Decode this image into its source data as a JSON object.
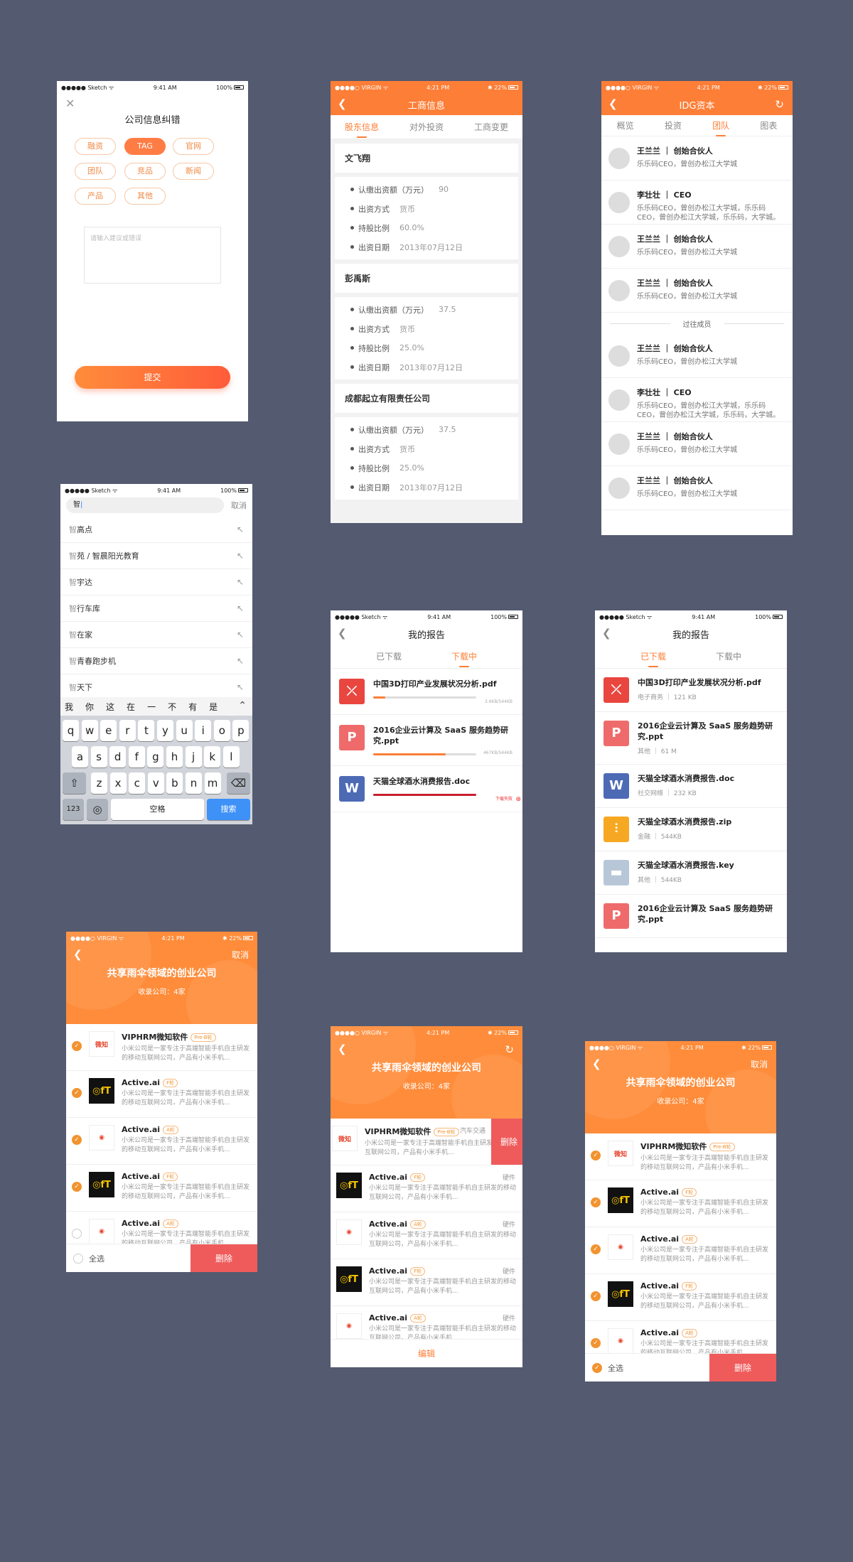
{
  "status": {
    "carrier_sketch": "●●●●● Sketch ᯤ",
    "time_941": "9:41 AM",
    "battery_100": "100%",
    "carrier_virgin": "●●●●○ VIRGIN ᯤ",
    "time_421": "4:21 PM",
    "battery_22": "✱ 22%"
  },
  "feedback": {
    "title": "公司信息纠错",
    "chips": [
      "融资",
      "TAG",
      "官网",
      "团队",
      "竞品",
      "新闻",
      "产品",
      "其他"
    ],
    "placeholder": "请输入建议或错误",
    "submit": "提交"
  },
  "business": {
    "title": "工商信息",
    "tabs": [
      "股东信息",
      "对外投资",
      "工商变更"
    ],
    "labels": [
      "认缴出资额（万元）",
      "出资方式",
      "持股比例",
      "出资日期"
    ],
    "holders": [
      {
        "name": "文飞翔",
        "values": [
          "90",
          "货币",
          "60.0%",
          "2013年07月12日"
        ]
      },
      {
        "name": "彭禹斯",
        "values": [
          "37.5",
          "货币",
          "25.0%",
          "2013年07月12日"
        ]
      },
      {
        "name": "成都起立有限责任公司",
        "values": [
          "37.5",
          "货币",
          "25.0%",
          "2013年07月12日"
        ]
      }
    ]
  },
  "idg": {
    "title": "IDG资本",
    "tabs": [
      "概览",
      "投资",
      "团队",
      "图表"
    ],
    "members": [
      {
        "name": "王兰兰 ｜ 创始合伙人",
        "desc": "乐乐码CEO，曾创办松江大学城"
      },
      {
        "name": "李壮壮 ｜ CEO",
        "desc": "乐乐码CEO，曾创办松江大学城，乐乐码CEO，曾创办松江大学城，乐乐码，大学城。"
      },
      {
        "name": "王兰兰 ｜ 创始合伙人",
        "desc": "乐乐码CEO，曾创办松江大学城"
      },
      {
        "name": "王兰兰 ｜ 创始合伙人",
        "desc": "乐乐码CEO，曾创办松江大学城"
      }
    ],
    "past_label": "过往成员",
    "past_members": [
      {
        "name": "王兰兰 ｜ 创始合伙人",
        "desc": "乐乐码CEO，曾创办松江大学城"
      },
      {
        "name": "李壮壮 ｜ CEO",
        "desc": "乐乐码CEO，曾创办松江大学城，乐乐码CEO，曾创办松江大学城，乐乐码，大学城。"
      },
      {
        "name": "王兰兰 ｜ 创始合伙人",
        "desc": "乐乐码CEO，曾创办松江大学城"
      },
      {
        "name": "王兰兰 ｜ 创始合伙人",
        "desc": "乐乐码CEO，曾创办松江大学城"
      }
    ]
  },
  "search": {
    "query": "智",
    "cancel": "取消",
    "suggestions": [
      "智高点",
      "智苑 / 智晨阳光教育",
      "智宇达",
      "智行车库",
      "智在家",
      "智青春跑步机",
      "智天下"
    ],
    "candidates": [
      "我",
      "你",
      "这",
      "在",
      "一",
      "不",
      "有",
      "是"
    ],
    "row1": [
      "q",
      "w",
      "e",
      "r",
      "t",
      "y",
      "u",
      "i",
      "o",
      "p"
    ],
    "row2": [
      "a",
      "s",
      "d",
      "f",
      "g",
      "h",
      "j",
      "k",
      "l"
    ],
    "row3": [
      "z",
      "x",
      "c",
      "v",
      "b",
      "n",
      "m"
    ],
    "num": "123",
    "space": "空格",
    "go": "搜索"
  },
  "reports_downloading": {
    "title": "我的报告",
    "tabs": [
      "已下载",
      "下载中"
    ],
    "items": [
      {
        "name": "中国3D打印产业发展状况分析.pdf",
        "icon": "pdf",
        "progress": 0.12,
        "meta": "3.6KB/544KB"
      },
      {
        "name": "2016企业云计算及 SaaS 服务趋势研究.ppt",
        "icon": "ppt",
        "progress": 0.7,
        "meta": "467KB/544KB"
      },
      {
        "name": "天猫全球酒水消费报告.doc",
        "icon": "doc",
        "progress": 1.0,
        "meta": "下载失败"
      }
    ]
  },
  "reports_downloaded": {
    "title": "我的报告",
    "tabs": [
      "已下载",
      "下载中"
    ],
    "items": [
      {
        "name": "中国3D打印产业发展状况分析.pdf",
        "icon": "pdf",
        "meta": "电子商务 ｜ 121 KB"
      },
      {
        "name": "2016企业云计算及 SaaS 服务趋势研究.ppt",
        "icon": "ppt",
        "meta": "其他 ｜ 61 M"
      },
      {
        "name": "天猫全球酒水消费报告.doc",
        "icon": "doc",
        "meta": "社交网络 ｜ 232 KB"
      },
      {
        "name": "天猫全球酒水消费报告.zip",
        "icon": "zip",
        "meta": "金融 ｜ 544KB"
      },
      {
        "name": "天猫全球酒水消费报告.key",
        "icon": "key",
        "meta": "其他 ｜ 544KB"
      },
      {
        "name": "2016企业云计算及 SaaS 服务趋势研究.ppt",
        "icon": "ppt",
        "meta": ""
      }
    ]
  },
  "collection": {
    "title": "共享雨伞领域的创业公司",
    "subtitle": "收录公司：4家",
    "cancel": "取消",
    "select_all": "全选",
    "delete": "删除",
    "edit": "编辑",
    "desc": "小米公司是一家专注于高端智能手机自主研发的移动互联网公司，产品有小米手机...",
    "companies": [
      {
        "name": "VIPHRM微知软件",
        "tag": "Pre-B轮",
        "logo": "微知",
        "style": "wht",
        "category": "汽车交通"
      },
      {
        "name": "Active.ai",
        "tag": "F轮",
        "logo": "◎fT",
        "style": "blk",
        "category": "硬件"
      },
      {
        "name": "Active.ai",
        "tag": "A轮",
        "logo": "◉",
        "style": "wht",
        "category": "硬件"
      },
      {
        "name": "Active.ai",
        "tag": "F轮",
        "logo": "◎fT",
        "style": "blk",
        "category": "硬件"
      },
      {
        "name": "Active.ai",
        "tag": "A轮",
        "logo": "◉",
        "style": "wht",
        "category": "硬件"
      }
    ]
  },
  "colors": {
    "accent": "#fd7e36",
    "danger": "#ef5b5b",
    "background": "#545a70"
  }
}
